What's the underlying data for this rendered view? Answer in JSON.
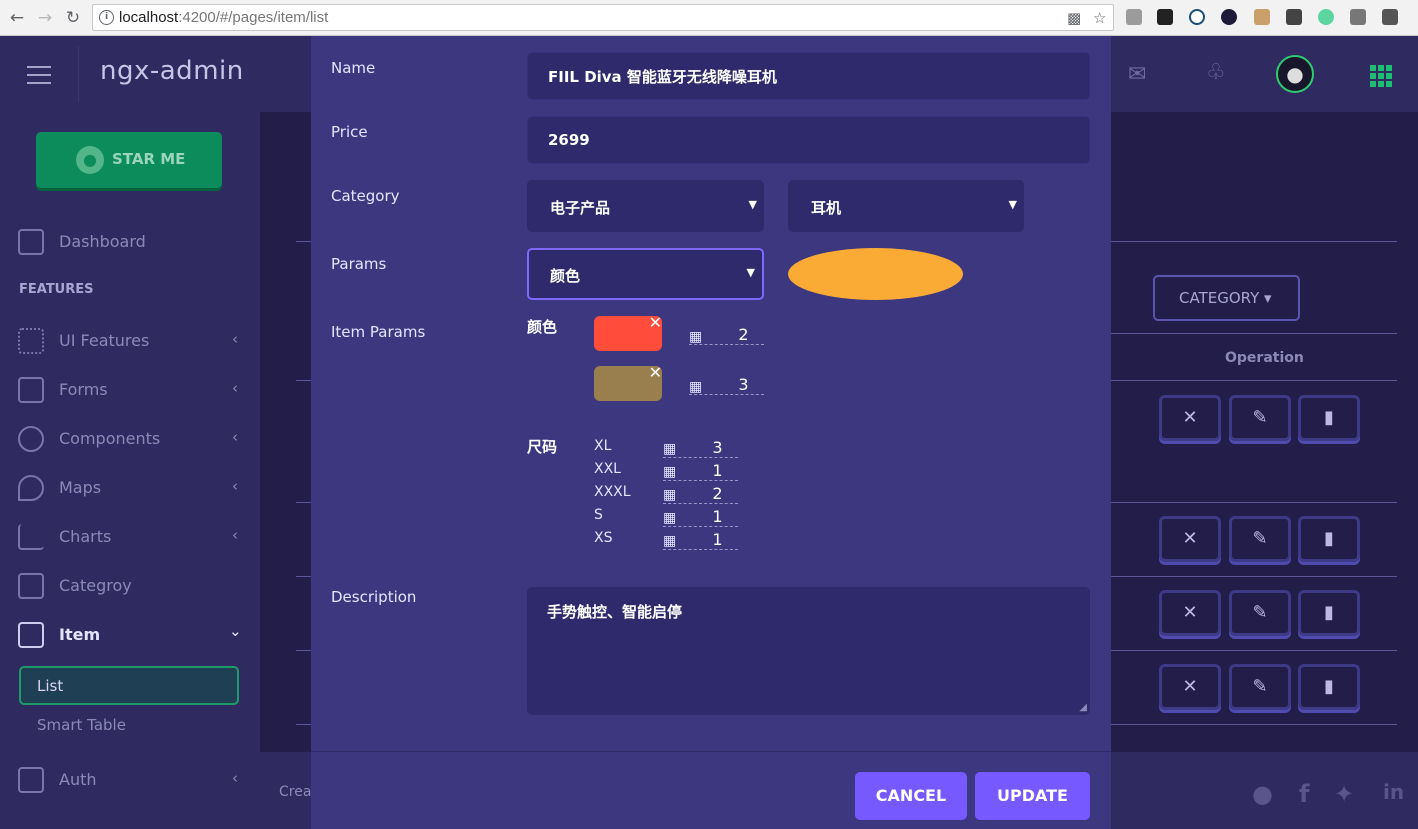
{
  "browser": {
    "url_host": "localhost",
    "url_rest": ":4200/#/pages/item/list"
  },
  "header": {
    "brand": "ngx-admin"
  },
  "sidebar": {
    "star_button": "STAR ME",
    "features_title": "FEATURES",
    "items": [
      {
        "label": "Dashboard"
      },
      {
        "label": "UI Features"
      },
      {
        "label": "Forms"
      },
      {
        "label": "Components"
      },
      {
        "label": "Maps"
      },
      {
        "label": "Charts"
      },
      {
        "label": "Categroy"
      },
      {
        "label": "Item"
      },
      {
        "label": "Auth"
      }
    ],
    "sub_items": [
      {
        "label": "List"
      },
      {
        "label": "Smart Table"
      }
    ]
  },
  "main": {
    "category_button": "CATEGORY ▾",
    "operation_header": "Operation",
    "footer_text": "Crea"
  },
  "modal": {
    "labels": {
      "name": "Name",
      "price": "Price",
      "category": "Category",
      "params": "Params",
      "item_params": "Item Params",
      "description": "Description"
    },
    "name_value": "FIIL Diva 智能蓝牙无线降噪耳机",
    "price_value": "2699",
    "category_primary": "电子产品",
    "category_secondary": "耳机",
    "params_select": "颜色",
    "param_color_hex": "#f9ab35",
    "item_params": {
      "color_group": {
        "title": "颜色",
        "entries": [
          {
            "swatch": "#ff4c3b",
            "qty": "2"
          },
          {
            "swatch": "#9a7f4e",
            "qty": "3"
          }
        ]
      },
      "size_group": {
        "title": "尺码",
        "entries": [
          {
            "size": "XL",
            "qty": "3"
          },
          {
            "size": "XXL",
            "qty": "1"
          },
          {
            "size": "XXXL",
            "qty": "2"
          },
          {
            "size": "S",
            "qty": "1"
          },
          {
            "size": "XS",
            "qty": "1"
          }
        ]
      }
    },
    "description_value": "手势触控、智能启停",
    "cancel_label": "CANCEL",
    "update_label": "UPDATE"
  }
}
